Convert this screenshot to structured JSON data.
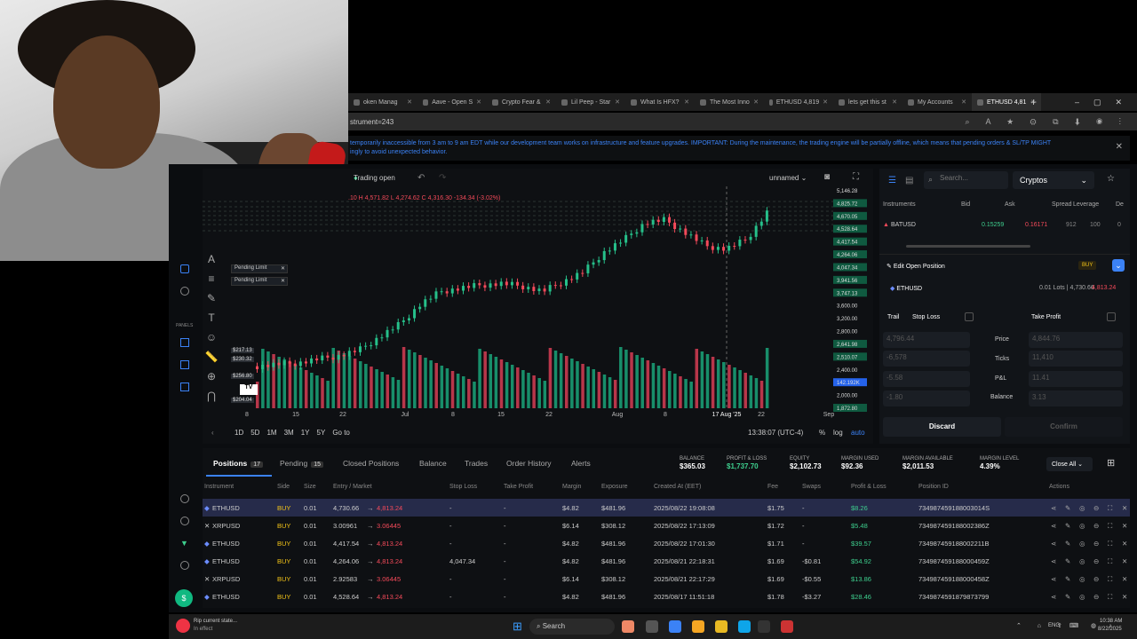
{
  "browser": {
    "tabs": [
      {
        "label": "oken Manag"
      },
      {
        "label": "Aave - Open S"
      },
      {
        "label": "Crypto Fear &"
      },
      {
        "label": "Lil Peep - Star"
      },
      {
        "label": "What Is HFX?"
      },
      {
        "label": "The Most Inno"
      },
      {
        "label": "ETHUSD 4,819"
      },
      {
        "label": "lets get this st"
      },
      {
        "label": "My Accounts"
      },
      {
        "label": "ETHUSD 4,81"
      }
    ],
    "url": "strument=243",
    "notice": "temporarily inaccessible from 3 am to 9 am EDT while our development team works on infrastructure and feature upgrades. IMPORTANT: During the maintenance, the trading engine will be partially offline, which means that pending orders & SL/TP MIGHT",
    "notice2": "ingly to avoid unexpected behavior."
  },
  "chart": {
    "status": "Trading open",
    "layout_name": "unnamed",
    "ohlc": ".10  H 4,571.82  L 4,274.62  C 4,316.30  -134.34 (-3.02%)",
    "pending1": "Pending Limit",
    "pending2": "Pending Limit",
    "price_labels": [
      "5,146.28",
      "4,825.72",
      "4,670.05",
      "4,528.64",
      "4,417.54",
      "4,264.06",
      "4,047.34",
      "3,941.56",
      "3,747.13",
      "3,600.00",
      "3,200.00",
      "2,800.00",
      "2,641.98",
      "2,510.07",
      "2,400.00",
      "142.192K",
      "2,000.00",
      "1,872.80"
    ],
    "left_prices": [
      "$217.13",
      "$230.32",
      "$256.80",
      "$204.04"
    ],
    "x_ticks": [
      "8",
      "15",
      "22",
      "Jul",
      "8",
      "15",
      "22",
      "Aug",
      "8",
      "17 Aug '25",
      "22",
      "Sep"
    ],
    "timeframes": [
      "1D",
      "5D",
      "1M",
      "3M",
      "1Y",
      "5Y",
      "Go to"
    ],
    "clock": "13:38:07 (UTC-4)",
    "pct": "%",
    "log": "log",
    "auto": "auto",
    "panels_label": "PANELS"
  },
  "chart_data": {
    "type": "candlestick",
    "title": "",
    "xlabel": "",
    "ylabel": "",
    "ylim": [
      1872.8,
      5146.28
    ],
    "approx_closes": [
      2450,
      2480,
      2500,
      2560,
      2610,
      2700,
      2900,
      3100,
      3400,
      3600,
      3650,
      3700,
      3720,
      3680,
      3600,
      3750,
      3900,
      4200,
      4400,
      4650,
      4700,
      4500,
      4300,
      4250,
      4400,
      4813
    ]
  },
  "right": {
    "search_placeholder": "Search...",
    "category": "Cryptos",
    "headers": [
      "Instruments",
      "Bid",
      "Ask",
      "Spread",
      "Leverage",
      "De"
    ],
    "instrument": {
      "name": "BATUSD",
      "bid": "0.15259",
      "ask": "0.16171",
      "spread": "912",
      "leverage": "100",
      "extra": "0"
    },
    "edit_title": "Edit Open Position",
    "edit_badge": "BUY",
    "pos_name": "ETHUSD",
    "pos_info": "0.01 Lots | 4,730.66",
    "pos_price": "4,813.24",
    "trail": "Trail",
    "stop_loss": "Stop Loss",
    "take_profit": "Take Profit",
    "sl_val1": "4,796.44",
    "sl_val2": "-6,578",
    "sl_val3": "-5.58",
    "sl_val4": "-1.80",
    "tp_val1": "4,844.76",
    "tp_val2": "11,410",
    "tp_val3": "11.41",
    "tp_val4": "3.13",
    "price_label": "Price",
    "ticks_label": "Ticks",
    "pnl_label": "P&L",
    "balance_label": "Balance",
    "discard": "Discard",
    "confirm": "Confirm"
  },
  "bottom": {
    "tabs": [
      {
        "label": "Positions",
        "count": "17"
      },
      {
        "label": "Pending",
        "count": "15"
      },
      {
        "label": "Closed Positions",
        "count": ""
      },
      {
        "label": "Balance",
        "count": ""
      },
      {
        "label": "Trades",
        "count": ""
      },
      {
        "label": "Order History",
        "count": ""
      },
      {
        "label": "Alerts",
        "count": ""
      }
    ],
    "stats": [
      {
        "label": "BALANCE",
        "value": "$365.03",
        "color": "#ffffff"
      },
      {
        "label": "PROFIT & LOSS",
        "value": "$1,737.70",
        "color": "#3ecf8e"
      },
      {
        "label": "EQUITY",
        "value": "$2,102.73",
        "color": "#ffffff"
      },
      {
        "label": "MARGIN USED",
        "value": "$92.36",
        "color": "#ffffff"
      },
      {
        "label": "MARGIN AVAILABLE",
        "value": "$2,011.53",
        "color": "#ffffff"
      },
      {
        "label": "MARGIN LEVEL",
        "value": "4.39%",
        "color": "#ffffff"
      }
    ],
    "close_all": "Close All",
    "columns": [
      "Instrument",
      "Side",
      "Size",
      "Entry / Market",
      "Stop Loss",
      "Take Profit",
      "Margin",
      "Exposure",
      "Created At (EET)",
      "Fee",
      "Swaps",
      "Profit & Loss",
      "Position ID",
      "Actions"
    ],
    "rows": [
      {
        "inst": "ETHUSD",
        "side": "BUY",
        "size": "0.01",
        "entry": "4,730.66",
        "market": "4,813.24",
        "sl": "-",
        "tp": "-",
        "margin": "$4.82",
        "exposure": "$481.96",
        "created": "2025/08/22 19:08:08",
        "fee": "$1.75",
        "swaps": "-",
        "pnl": "$8.26",
        "id": "734987459188003014S"
      },
      {
        "inst": "XRPUSD",
        "side": "BUY",
        "size": "0.01",
        "entry": "3.00961",
        "market": "3.06445",
        "sl": "-",
        "tp": "-",
        "margin": "$6.14",
        "exposure": "$308.12",
        "created": "2025/08/22 17:13:09",
        "fee": "$1.72",
        "swaps": "-",
        "pnl": "$5.48",
        "id": "734987459188002386Z"
      },
      {
        "inst": "ETHUSD",
        "side": "BUY",
        "size": "0.01",
        "entry": "4,417.54",
        "market": "4,813.24",
        "sl": "-",
        "tp": "-",
        "margin": "$4.82",
        "exposure": "$481.96",
        "created": "2025/08/22 17:01:30",
        "fee": "$1.71",
        "swaps": "-",
        "pnl": "$39.57",
        "id": "734987459188002211B"
      },
      {
        "inst": "ETHUSD",
        "side": "BUY",
        "size": "0.01",
        "entry": "4,264.06",
        "market": "4,813.24",
        "sl": "4,047.34",
        "tp": "-",
        "margin": "$4.82",
        "exposure": "$481.96",
        "created": "2025/08/21 22:18:31",
        "fee": "$1.69",
        "swaps": "-$0.81",
        "pnl": "$54.92",
        "id": "734987459188000459Z"
      },
      {
        "inst": "XRPUSD",
        "side": "BUY",
        "size": "0.01",
        "entry": "2.92583",
        "market": "3.06445",
        "sl": "-",
        "tp": "-",
        "margin": "$6.14",
        "exposure": "$308.12",
        "created": "2025/08/21 22:17:29",
        "fee": "$1.69",
        "swaps": "-$0.55",
        "pnl": "$13.86",
        "id": "734987459188000458Z"
      },
      {
        "inst": "ETHUSD",
        "side": "BUY",
        "size": "0.01",
        "entry": "4,528.64",
        "market": "4,813.24",
        "sl": "-",
        "tp": "-",
        "margin": "$4.82",
        "exposure": "$481.96",
        "created": "2025/08/17 11:51:18",
        "fee": "$1.78",
        "swaps": "-$3.27",
        "pnl": "$28.46",
        "id": "7349874591879873799"
      }
    ]
  },
  "taskbar": {
    "notif_title": "Rip current state...",
    "notif_sub": "In effect",
    "search": "Search",
    "lang": "ENG",
    "time": "10:38 AM",
    "date": "8/22/2025"
  }
}
